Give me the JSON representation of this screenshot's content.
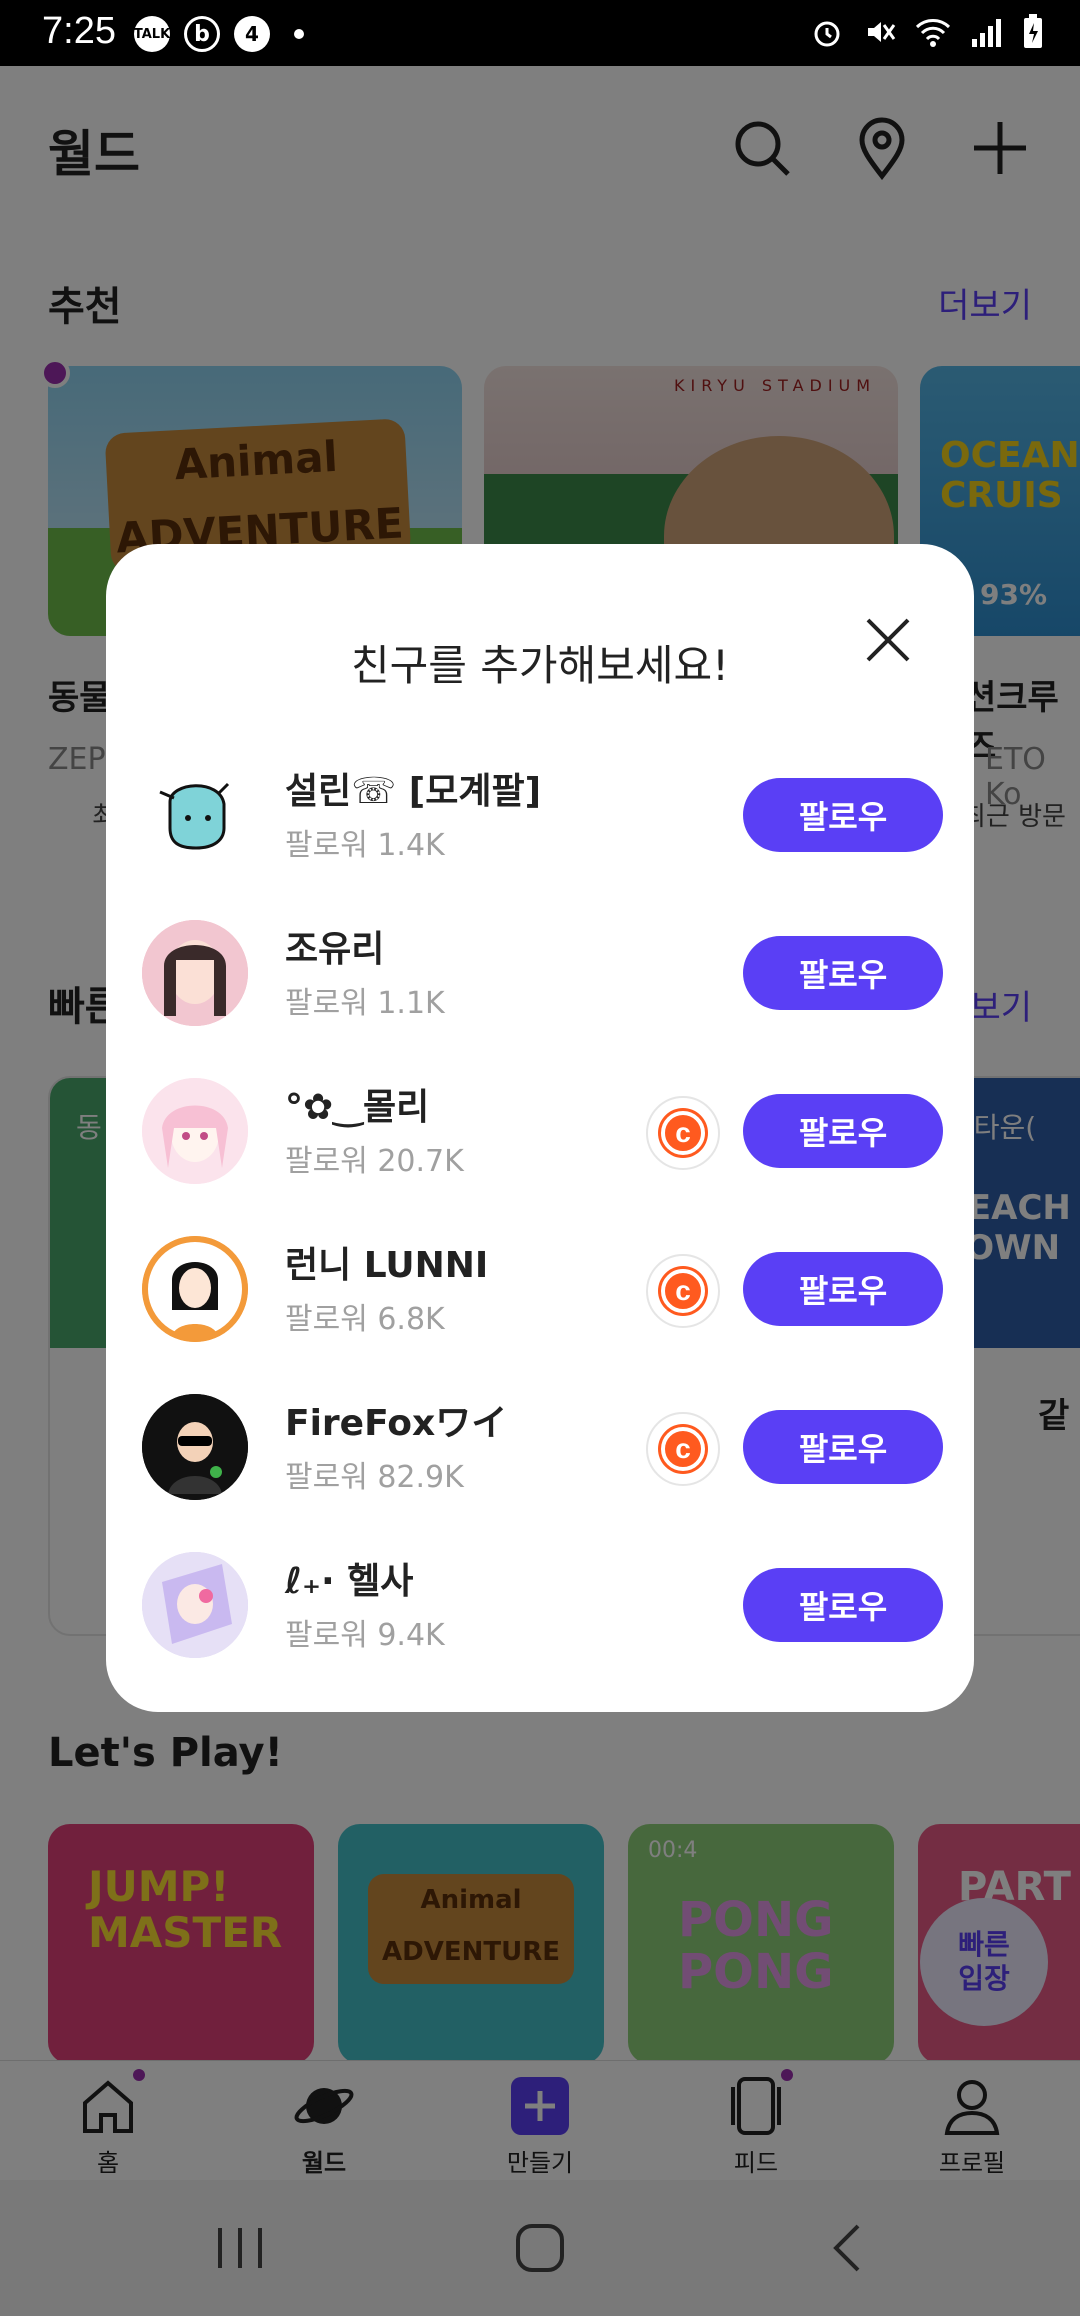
{
  "status_bar": {
    "time": "7:25",
    "left_icons": [
      "talk-icon",
      "b-icon",
      "4-icon",
      "dot-icon"
    ],
    "right_icons": [
      "alarm-icon",
      "mute-icon",
      "wifi-icon",
      "signal-icon",
      "battery-icon"
    ]
  },
  "header": {
    "title": "월드",
    "icons": [
      "search-icon",
      "location-pin-icon",
      "plus-icon"
    ]
  },
  "sections": {
    "recommended": {
      "title": "추천",
      "more": "더보기",
      "cards": [
        {
          "title": "동물",
          "sub": "ZEP",
          "art_text": "Animal ADVENTURE"
        },
        {
          "title": "",
          "sub": "",
          "art_text": "KIRYU STADIUM"
        },
        {
          "title": "션크루즈",
          "sub": "ETO Ko",
          "art_text": "OCEAN CRUIS",
          "badge": "93%",
          "meta": "최근 방문"
        }
      ],
      "first_card_meta": "최"
    },
    "quick": {
      "title": "빠른",
      "more": "보기",
      "cards": [
        {
          "tag": "동",
          "art_text": ""
        },
        {
          "tag": "치타운(",
          "art_text": "BEACH TOWN",
          "title": "같"
        }
      ]
    },
    "lets_play": {
      "title": "Let's Play!",
      "cards": [
        {
          "art_text": "JUMP! MASTER"
        },
        {
          "art_text": "Animal ADVENTURE"
        },
        {
          "art_text": "PONG PONG",
          "timer": "00:4"
        },
        {
          "art_text": "PART"
        }
      ]
    }
  },
  "quick_entry": {
    "label_line1": "빠른",
    "label_line2": "입장"
  },
  "bottom_nav": [
    {
      "label": "홈",
      "icon": "home-icon",
      "badge": true
    },
    {
      "label": "월드",
      "icon": "planet-icon",
      "badge": false
    },
    {
      "label": "만들기",
      "icon": "plus-square-icon",
      "badge": false
    },
    {
      "label": "피드",
      "icon": "feed-icon",
      "badge": true
    },
    {
      "label": "프로필",
      "icon": "profile-icon",
      "badge": false
    }
  ],
  "system_nav": [
    "recents-icon",
    "home-circle-icon",
    "back-icon"
  ],
  "modal": {
    "title": "친구를 추가해보세요!",
    "close_icon": "close-icon",
    "users": [
      {
        "name": "설린☏ [모계팔]",
        "followers": "팔로워 1.4K",
        "creator": false,
        "follow_label": "팔로우",
        "avatar_color": "#7fd3d8"
      },
      {
        "name": "조유리",
        "followers": "팔로워 1.1K",
        "creator": false,
        "follow_label": "팔로우",
        "avatar_color": "#f2b7c4"
      },
      {
        "name": "°✿‿몰리",
        "followers": "팔로워 20.7K",
        "creator": true,
        "follow_label": "팔로우",
        "avatar_color": "#f8c9da"
      },
      {
        "name": "런니 LUNNI",
        "followers": "팔로워 6.8K",
        "creator": true,
        "follow_label": "팔로우",
        "avatar_color": "#f39a3a"
      },
      {
        "name": "FireFoxワイ",
        "followers": "팔로워 82.9K",
        "creator": true,
        "follow_label": "팔로우",
        "avatar_color": "#111111"
      },
      {
        "name": "ℓ₊· 헬사",
        "followers": "팔로워 9.4K",
        "creator": false,
        "follow_label": "팔로우",
        "avatar_color": "#d9d2f0"
      }
    ],
    "creator_badge_symbol": "c"
  }
}
